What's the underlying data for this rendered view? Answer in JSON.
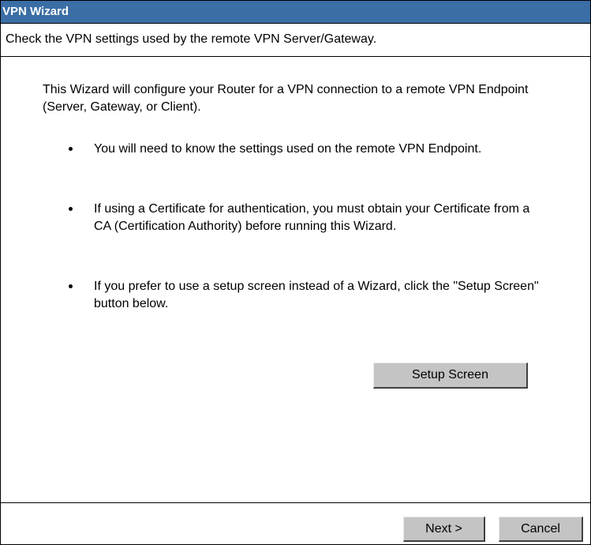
{
  "window": {
    "title": "VPN Wizard"
  },
  "header": {
    "subtitle": "Check the VPN settings used by the remote VPN Server/Gateway."
  },
  "main": {
    "intro": "This Wizard will configure your Router for a VPN connection to a remote VPN Endpoint (Server, Gateway, or Client).",
    "bullets": [
      "You will need to know the settings used on the remote VPN Endpoint.",
      "If using a Certificate for authentication, you must obtain your Certificate from a CA (Certification Authority) before running this Wizard.",
      "If you prefer to use a setup screen instead of a Wizard, click the \"Setup Screen\" button below."
    ],
    "setup_button_label": "Setup Screen"
  },
  "footer": {
    "next_label": "Next >",
    "cancel_label": "Cancel"
  },
  "colors": {
    "titlebar_bg": "#3a6ea5",
    "button_face": "#c4c4c4"
  }
}
